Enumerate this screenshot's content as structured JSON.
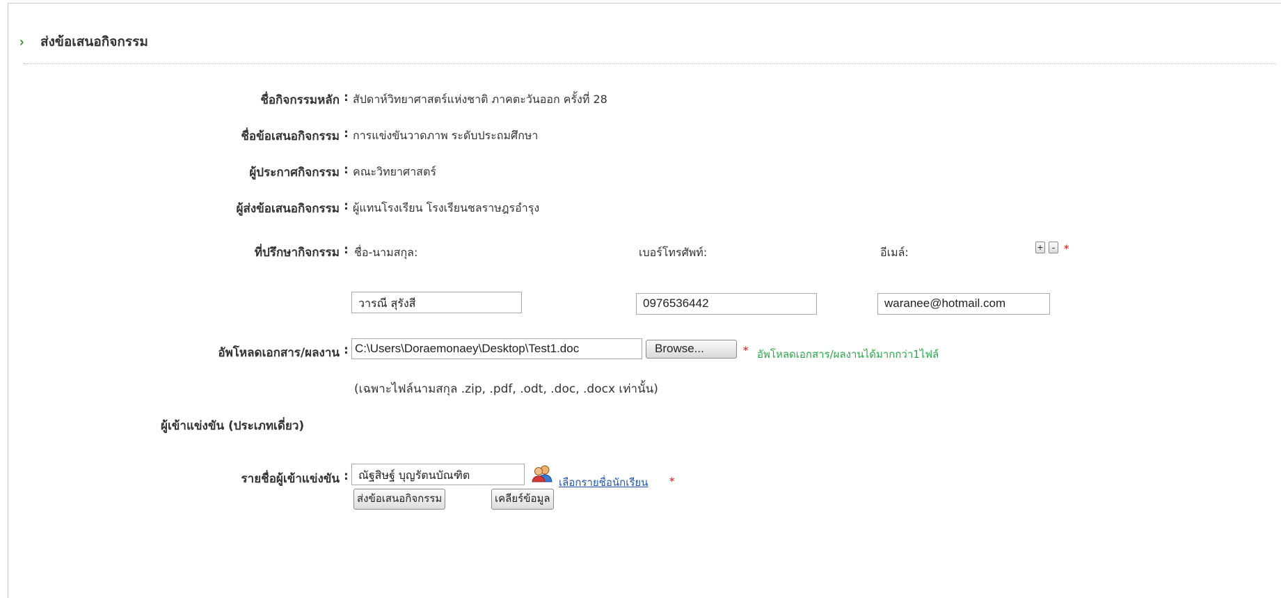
{
  "header": {
    "title": "ส่งข้อเสนอกิจกรรม"
  },
  "fields": {
    "main_activity": {
      "label": "ชื่อกิจกรรมหลัก",
      "value": "สัปดาห์วิทยาศาสตร์แห่งชาติ ภาคตะวันออก ครั้งที่ 28"
    },
    "proposal_name": {
      "label": "ชื่อข้อเสนอกิจกรรม",
      "value": "การแข่งขันวาดภาพ ระดับประถมศึกษา"
    },
    "announcer": {
      "label": "ผู้ประกาศกิจกรรม",
      "value": "คณะวิทยาศาสตร์"
    },
    "submitter": {
      "label": "ผู้ส่งข้อเสนอกิจกรรม",
      "value": "ผู้แทนโรงเรียน โรงเรียนชลราษฎรอำรุง"
    }
  },
  "colon": ":",
  "advisor": {
    "label": "ที่ปรึกษากิจกรรม",
    "name_header": "ชื่อ-นามสกุล:",
    "phone_header": "เบอร์โทรศัพท์:",
    "email_header": "อีเมล์:",
    "name_value": "วารณี  สุรังสี",
    "phone_value": "0976536442",
    "email_value": "waranee@hotmail.com",
    "add_label": "+",
    "remove_label": "-"
  },
  "required_mark": "*",
  "upload": {
    "label": "อัพโหลดเอกสาร/ผลงาน",
    "file_path": "C:\\Users\\Doraemonaey\\Desktop\\Test1.doc",
    "browse_label": "Browse...",
    "multi_note": "อัพโหลดเอกสาร/ผลงานได้มากกว่า1ไฟล์",
    "extensions_note": "(เฉพาะไฟล์นามสกุล .zip, .pdf, .odt, .doc, .docx เท่านั้น)"
  },
  "competitors": {
    "section_title": "ผู้เข้าแข่งขัน (ประเภทเดี่ยว)",
    "label": "รายชื่อผู้เข้าแข่งขัน",
    "value": "ณัฐสิษฐ์  บุญรัตนบัณฑิต",
    "select_link": "เลือกรายชื่อนักเรียน"
  },
  "actions": {
    "submit_label": "ส่งข้อเสนอกิจกรรม",
    "clear_label": "เคลียร์ข้อมูล"
  },
  "colors": {
    "accent_green": "#3a8a1e",
    "note_green": "#2aa748",
    "required_red": "#e04040",
    "link_blue": "#2255aa"
  },
  "icons": {
    "header": "chevron-right-icon",
    "select_students": "users-icon"
  }
}
